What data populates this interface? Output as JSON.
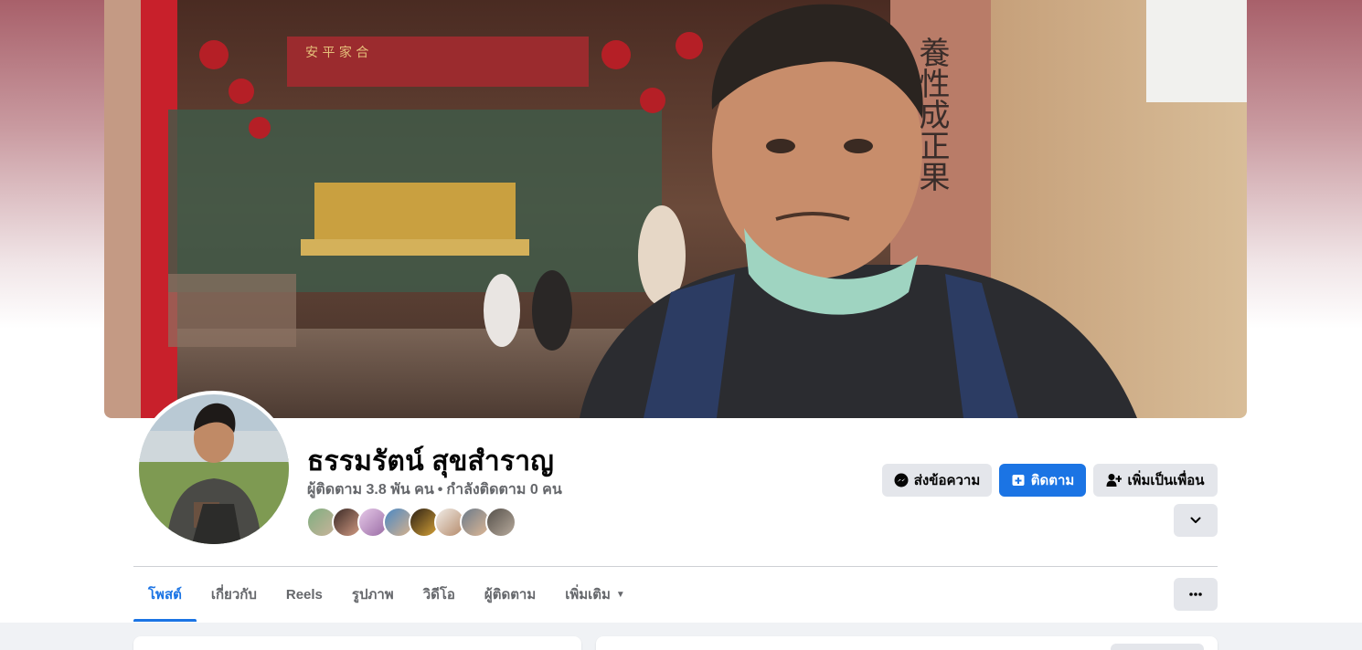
{
  "profile": {
    "name": "ธรรมรัตน์ สุขสำราญ",
    "followers_text": "ผู้ติดตาม 3.8 พัน คน",
    "separator": "•",
    "following_text": "กำลังติดตาม 0 คน"
  },
  "actions": {
    "message_label": "ส่งข้อความ",
    "follow_label": "ติดตาม",
    "add_friend_label": "เพิ่มเป็นเพื่อน"
  },
  "tabs": [
    {
      "label": "โพสต์",
      "active": true
    },
    {
      "label": "เกี่ยวกับ"
    },
    {
      "label": "Reels"
    },
    {
      "label": "รูปภาพ"
    },
    {
      "label": "วิดีโอ"
    },
    {
      "label": "ผู้ติดตาม"
    },
    {
      "label": "เพิ่มเติม",
      "dropdown": true
    }
  ],
  "icons": {
    "message": "messenger-icon",
    "follow": "follow-icon",
    "add_friend": "add-friend-icon",
    "expand": "chevron-down-icon",
    "more": "more-dots-icon"
  },
  "colors": {
    "accent": "#1b74e4",
    "button_gray": "#e4e6eb",
    "text_primary": "#050505",
    "text_secondary": "#65676b"
  },
  "cover_signboard_text": "養性成正果",
  "temple_banner_text": "安 平 家 合"
}
